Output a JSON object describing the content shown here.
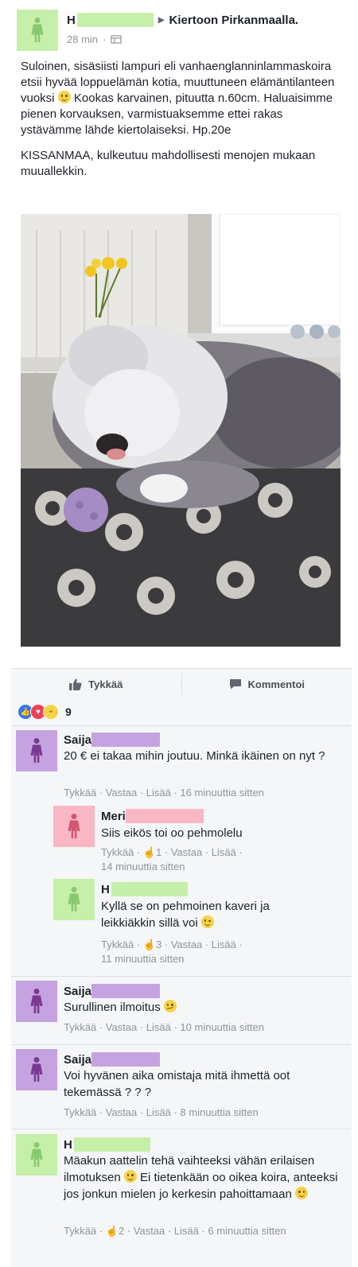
{
  "post": {
    "author_initial": "H",
    "group": "Kiertoon Pirkanmaalla.",
    "time": "28 min",
    "body_1a": "Suloinen, sisäsiisti lampuri eli vanhaenglanninlammaskoira etsii hyvää loppuelämän kotia, muuttuneen elämäntilanteen vuoksi",
    "body_1b": "Kookas karvainen, pituutta n.60cm. Haluaisimme pienen korvauksen, varmistuaksemme ettei rakas ystävämme lähde kiertolaiseksi. Hp.20e",
    "body_2": "KISSANMAA, kulkeutuu mahdollisesti menojen mukaan muuallekkin."
  },
  "actions": {
    "like": "Tykkää",
    "comment": "Kommentoi"
  },
  "reactions": {
    "count": "9"
  },
  "colors": {
    "green": "#c6efa9",
    "green_person": "#88c870",
    "purple": "#c5a3e0",
    "purple_person": "#7a3a93",
    "pink": "#f9b6c4",
    "pink_person": "#d1566f",
    "link_gray": "#90949c"
  },
  "comments": [
    {
      "name": "Saija",
      "text": "20 € ei takaa mihin joutuu. Minkä ikäinen on nyt ?",
      "actions": "Tykkää · Vastaa · Lisää · 16 minuuttia sitten"
    },
    {
      "name": "Meri",
      "text": "Siis eikös toi oo pehmolelu",
      "actions_1": "Tykkää · ",
      "likes": "1",
      "actions_2": " · Vastaa · Lisää ·",
      "time": "14 minuuttia sitten"
    },
    {
      "name": "H",
      "text_a": "Kyllä se on pehmoinen kaveri ja",
      "text_b": "leikkiäkkin sillä voi",
      "actions_1": "Tykkää · ",
      "likes": "3",
      "actions_2": " · Vastaa · Lisää ·",
      "time": "11 minuuttia sitten"
    },
    {
      "name": "Saija",
      "text": "Surullinen ilmoitus",
      "actions": "Tykkää · Vastaa · Lisää · 10 minuuttia sitten"
    },
    {
      "name": "Saija",
      "text": "Voi hyvänen aika omistaja mitä ihmettä oot tekemässä ? ? ?",
      "actions": "Tykkää · Vastaa · Lisää · 8 minuuttia sitten"
    },
    {
      "name": "H",
      "text_a": "Mäakun aattelin tehä vaihteeksi vähän erilaisen ilmotuksen",
      "text_b": "Ei tietenkään oo oikea koira, anteeksi jos jonkun mielen jo kerkesin pahoittamaan",
      "actions_1": "Tykkää · ",
      "likes": "2",
      "actions_2": " · Vastaa · Lisää · 6 minuuttia sitten"
    }
  ]
}
